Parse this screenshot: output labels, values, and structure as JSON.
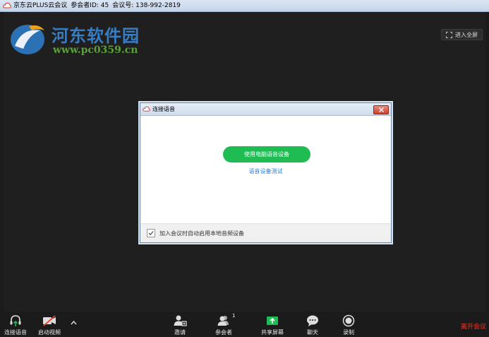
{
  "titlebar": {
    "app_name": "京东云PLUS云会议",
    "participant_id": "参会者ID: 45",
    "meeting_id": "会议号: 138-992-2819"
  },
  "watermark": {
    "title": "河东软件园",
    "url": "www.pc0359.cn"
  },
  "fullscreen": {
    "label": "进入全屏"
  },
  "dialog": {
    "title": "连接语音",
    "primary_button": "使用电脑语音设备",
    "test_link": "语音设备测试",
    "auto_join_label": "加入会议时自动启用本地音频设备",
    "auto_join_checked": true
  },
  "toolbar": {
    "connect_audio": "连接语音",
    "start_video": "启动视频",
    "invite": "邀请",
    "participants": "参会者",
    "participant_count": "1",
    "share_screen": "共享屏幕",
    "chat": "聊天",
    "record": "录制",
    "leave": "离开会议"
  },
  "colors": {
    "primary_green": "#1fbc53",
    "leave_red": "#e53a2a",
    "link_blue": "#2e7fd3"
  }
}
